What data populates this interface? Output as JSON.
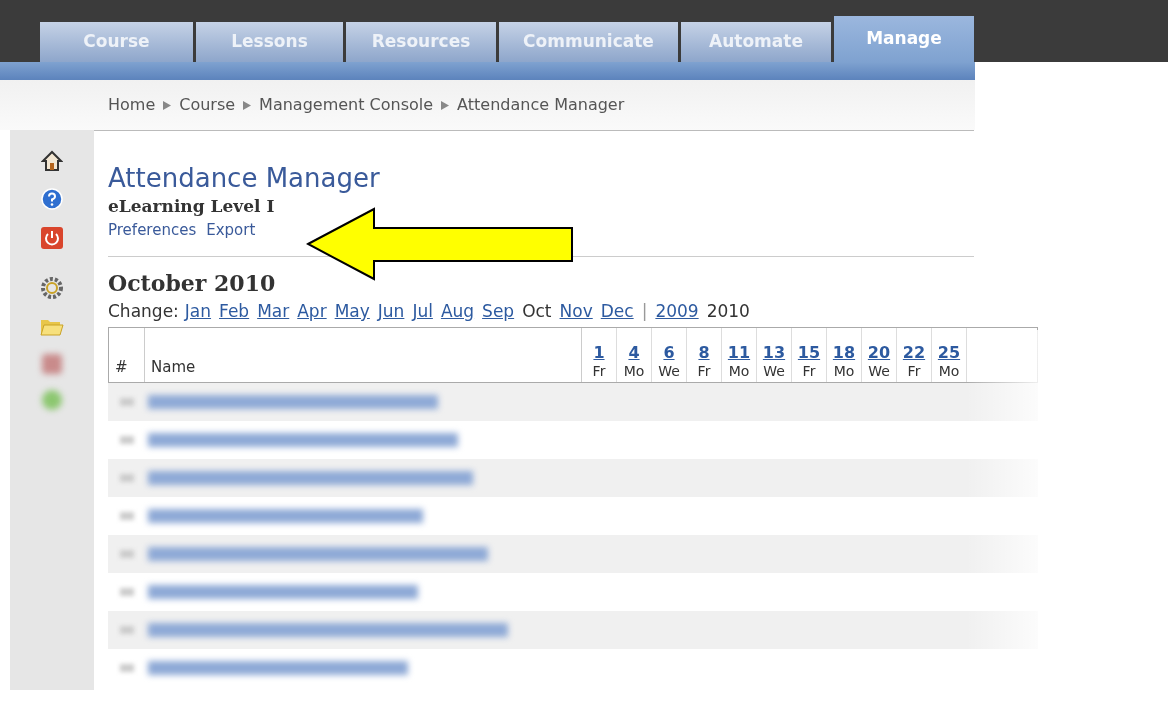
{
  "tabs": [
    {
      "label": "Course",
      "selected": false
    },
    {
      "label": "Lessons",
      "selected": false
    },
    {
      "label": "Resources",
      "selected": false
    },
    {
      "label": "Communicate",
      "selected": false
    },
    {
      "label": "Automate",
      "selected": false
    },
    {
      "label": "Manage",
      "selected": true
    }
  ],
  "breadcrumb": [
    "Home",
    "Course",
    "Management Console",
    "Attendance Manager"
  ],
  "page": {
    "title": "Attendance Manager",
    "subtitle": "eLearning Level I",
    "links": [
      "Preferences",
      "Export"
    ]
  },
  "calendar": {
    "heading": "October 2010",
    "change_label": "Change:",
    "months": [
      {
        "label": "Jan",
        "selected": false
      },
      {
        "label": "Feb",
        "selected": false
      },
      {
        "label": "Mar",
        "selected": false
      },
      {
        "label": "Apr",
        "selected": false
      },
      {
        "label": "May",
        "selected": false
      },
      {
        "label": "Jun",
        "selected": false
      },
      {
        "label": "Jul",
        "selected": false
      },
      {
        "label": "Aug",
        "selected": false
      },
      {
        "label": "Sep",
        "selected": false
      },
      {
        "label": "Oct",
        "selected": true
      },
      {
        "label": "Nov",
        "selected": false
      },
      {
        "label": "Dec",
        "selected": false
      }
    ],
    "separator": "|",
    "years": [
      {
        "label": "2009",
        "selected": false
      },
      {
        "label": "2010",
        "selected": true
      }
    ]
  },
  "table": {
    "columns": [
      "#",
      "Name"
    ],
    "dates": [
      {
        "day": "1",
        "weekday": "Fr"
      },
      {
        "day": "4",
        "weekday": "Mo"
      },
      {
        "day": "6",
        "weekday": "We"
      },
      {
        "day": "8",
        "weekday": "Fr"
      },
      {
        "day": "11",
        "weekday": "Mo"
      },
      {
        "day": "13",
        "weekday": "We"
      },
      {
        "day": "15",
        "weekday": "Fr"
      },
      {
        "day": "18",
        "weekday": "Mo"
      },
      {
        "day": "20",
        "weekday": "We"
      },
      {
        "day": "22",
        "weekday": "Fr"
      },
      {
        "day": "25",
        "weekday": "Mo"
      }
    ]
  }
}
